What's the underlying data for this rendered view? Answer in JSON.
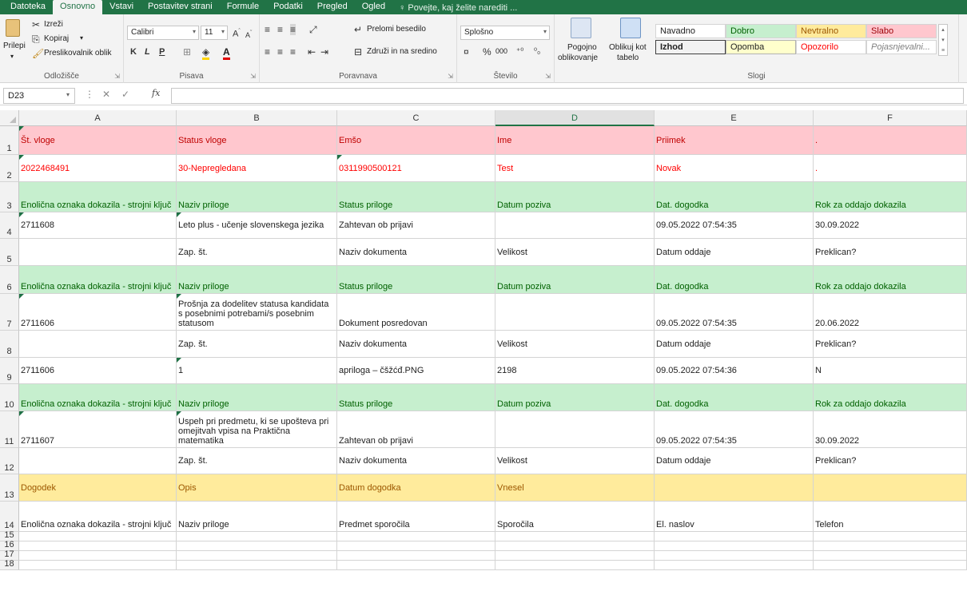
{
  "menu": {
    "tabs": [
      "Datoteka",
      "Osnovno",
      "Vstavi",
      "Postavitev strani",
      "Formule",
      "Podatki",
      "Pregled",
      "Ogled"
    ],
    "active_index": 1,
    "tell_me": "Povejte, kaj želite narediti ..."
  },
  "ribbon": {
    "clipboard": {
      "paste": "Prilepi",
      "cut": "Izreži",
      "copy": "Kopiraj",
      "format_painter": "Preslikovalnik oblik",
      "label": "Odložišče"
    },
    "font": {
      "name": "Calibri",
      "size": "11",
      "label": "Pisava",
      "bold": "K",
      "italic": "L",
      "underline": "P"
    },
    "alignment": {
      "wrap": "Prelomi besedilo",
      "merge": "Združi in na sredino",
      "label": "Poravnava"
    },
    "number": {
      "format": "Splošno",
      "thousands": "000",
      "label": "Število"
    },
    "styles": {
      "conditional": [
        "Pogojno",
        "oblikovanje"
      ],
      "table": [
        "Oblikuj kot",
        "tabelo"
      ],
      "cells": [
        {
          "label": "Navadno",
          "kind": "normal"
        },
        {
          "label": "Dobro",
          "kind": "good"
        },
        {
          "label": "Nevtralno",
          "kind": "neutral"
        },
        {
          "label": "Slabo",
          "kind": "bad"
        },
        {
          "label": "Izhod",
          "kind": "output"
        },
        {
          "label": "Opomba",
          "kind": "note"
        },
        {
          "label": "Opozorilo",
          "kind": "warning"
        },
        {
          "label": "Pojasnjevalni...",
          "kind": "explanatory"
        }
      ],
      "label": "Slogi"
    }
  },
  "formula_bar": {
    "name_box": "D23",
    "fx": "fx",
    "value": ""
  },
  "colors": {
    "accent": "#217346",
    "bad_fill": "#ffc7ce",
    "bad_text": "#c00000",
    "good_fill": "#c6efce",
    "good_text": "#006100",
    "neutral_fill": "#ffeb9c",
    "neutral_text": "#9c5700"
  },
  "sheet": {
    "columns": [
      "A",
      "B",
      "C",
      "D",
      "E",
      "F"
    ],
    "selected_column": "D",
    "rows": [
      {
        "num": "1",
        "style": "bad",
        "cells": [
          "Št. vloge",
          "Status vloge",
          "Emšo",
          "Ime",
          "Priimek",
          "."
        ]
      },
      {
        "num": "2",
        "style": "badtext",
        "cells": [
          "2022468491",
          "30-Nepregledana",
          "0311990500121",
          "Test",
          "Novak",
          "."
        ]
      },
      {
        "num": "3",
        "style": "good",
        "cells": [
          "Enolična oznaka dokazila - strojni ključ",
          "Naziv priloge",
          "Status priloge",
          "Datum poziva",
          "Dat. dogodka",
          "Rok za oddajo dokazila"
        ]
      },
      {
        "num": "4",
        "style": "plain",
        "cells": [
          "2711608",
          "Leto plus - učenje slovenskega jezika",
          "Zahtevan ob prijavi",
          "",
          "09.05.2022 07:54:35",
          "30.09.2022"
        ]
      },
      {
        "num": "5",
        "style": "plain",
        "cells": [
          "",
          "Zap. št.",
          "Naziv dokumenta",
          "Velikost",
          "Datum oddaje",
          "Preklican?"
        ]
      },
      {
        "num": "6",
        "style": "good",
        "cells": [
          "Enolična oznaka dokazila - strojni ključ",
          "Naziv priloge",
          "Status priloge",
          "Datum poziva",
          "Dat. dogodka",
          "Rok za oddajo dokazila"
        ]
      },
      {
        "num": "7",
        "style": "plain",
        "cells": [
          "2711606",
          "Prošnja za dodelitev statusa kandidata s posebnimi potrebami/s posebnim statusom",
          "Dokument posredovan",
          "",
          "09.05.2022 07:54:35",
          "20.06.2022"
        ]
      },
      {
        "num": "8",
        "style": "plain",
        "cells": [
          "",
          "Zap. št.",
          "Naziv dokumenta",
          "Velikost",
          "Datum oddaje",
          "Preklican?"
        ]
      },
      {
        "num": "9",
        "style": "plain",
        "cells": [
          "2711606",
          "1",
          "apriloga – čšžćđ.PNG",
          "2198",
          "09.05.2022 07:54:36",
          "N"
        ]
      },
      {
        "num": "10",
        "style": "good",
        "cells": [
          "Enolična oznaka dokazila - strojni ključ",
          "Naziv priloge",
          "Status priloge",
          "Datum poziva",
          "Dat. dogodka",
          "Rok za oddajo dokazila"
        ]
      },
      {
        "num": "11",
        "style": "plain",
        "cells": [
          "2711607",
          "Uspeh pri predmetu, ki se upošteva pri omejitvah vpisa na Praktična matematika",
          "Zahtevan ob prijavi",
          "",
          "09.05.2022 07:54:35",
          "30.09.2022"
        ]
      },
      {
        "num": "12",
        "style": "plain",
        "cells": [
          "",
          "Zap. št.",
          "Naziv dokumenta",
          "Velikost",
          "Datum oddaje",
          "Preklican?"
        ]
      },
      {
        "num": "13",
        "style": "neutral",
        "cells": [
          "Dogodek",
          "Opis",
          "Datum dogodka",
          "Vnesel",
          "",
          ""
        ]
      },
      {
        "num": "14",
        "style": "plain",
        "cells": [
          "Enolična oznaka dokazila - strojni ključ",
          "Naziv priloge",
          "Predmet sporočila",
          "Sporočila",
          "El. naslov",
          "Telefon"
        ]
      },
      {
        "num": "15",
        "style": "plain",
        "cells": [
          "",
          "",
          "",
          "",
          "",
          ""
        ]
      },
      {
        "num": "16",
        "style": "plain",
        "cells": [
          "",
          "",
          "",
          "",
          "",
          ""
        ]
      },
      {
        "num": "17",
        "style": "plain",
        "cells": [
          "",
          "",
          "",
          "",
          "",
          ""
        ]
      },
      {
        "num": "18",
        "style": "plain",
        "cells": [
          "",
          "",
          "",
          "",
          "",
          ""
        ]
      }
    ]
  }
}
